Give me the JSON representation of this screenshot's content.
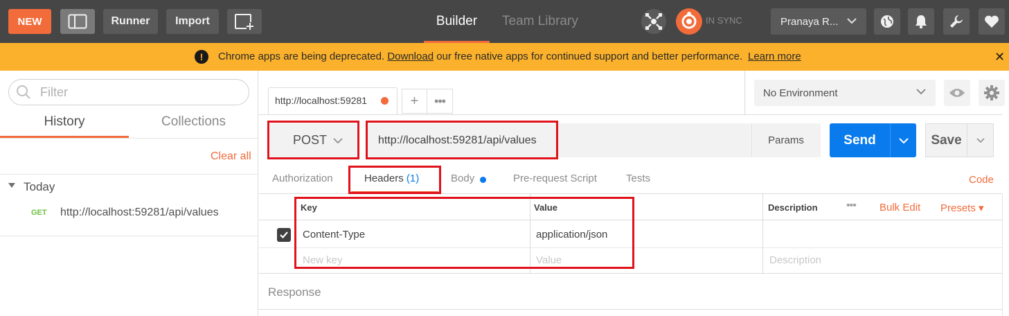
{
  "topbar": {
    "new_label": "NEW",
    "runner_label": "Runner",
    "import_label": "Import",
    "tab_builder": "Builder",
    "tab_team_library": "Team Library",
    "sync_status": "IN SYNC",
    "user_name": "Pranaya R...",
    "colors": {
      "bar": "#464646",
      "accent": "#f26b3a"
    }
  },
  "banner": {
    "message_before": "Chrome apps are being deprecated.",
    "download_link": "Download",
    "message_after": "our free native apps for continued support and better performance.",
    "learn_more": "Learn more",
    "color": "#fbb12b"
  },
  "sidebar": {
    "filter_placeholder": "Filter",
    "tabs": [
      {
        "label": "History"
      },
      {
        "label": "Collections"
      }
    ],
    "clear_all": "Clear all",
    "group_label": "Today",
    "history_items": [
      {
        "method": "GET",
        "url": "http://localhost:59281/api/values"
      }
    ]
  },
  "request_tabs": {
    "active_tab_label": "http://localhost:59281",
    "add_label": "+",
    "more_label": "•••"
  },
  "environment": {
    "selected": "No Environment"
  },
  "request": {
    "method": "POST",
    "url": "http://localhost:59281/api/values",
    "params_label": "Params",
    "send_label": "Send",
    "save_label": "Save",
    "send_color": "#097bed"
  },
  "subtabs": {
    "authorization": "Authorization",
    "headers": "Headers",
    "headers_count": "(1)",
    "body": "Body",
    "prerequest": "Pre-request Script",
    "tests": "Tests",
    "code": "Code"
  },
  "headers_table": {
    "columns": {
      "key": "Key",
      "value": "Value",
      "description": "Description"
    },
    "more": "•••",
    "bulk_edit": "Bulk Edit",
    "presets": "Presets",
    "rows": [
      {
        "key": "Content-Type",
        "value": "application/json",
        "checked": true
      }
    ],
    "placeholders": {
      "key": "New key",
      "value": "Value",
      "description": "Description"
    }
  },
  "response": {
    "label": "Response"
  },
  "annotations": {
    "highlight_color": "#e0121b"
  }
}
